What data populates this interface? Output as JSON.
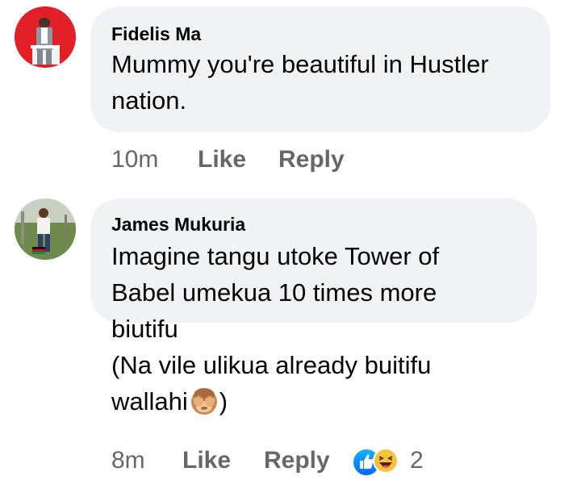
{
  "comments": [
    {
      "author": "Fidelis Ma",
      "lines": [
        "Mummy you're beautiful in Hustler",
        "nation."
      ],
      "time": "10m",
      "like_label": "Like",
      "reply_label": "Reply"
    },
    {
      "author": "James Mukuria",
      "lines": [
        "Imagine tangu utoke Tower of",
        "Babel umekua 10 times more",
        "biutifu",
        "(Na vile ulikua already buitifu",
        "wallahi",
        ")"
      ],
      "time": "8m",
      "like_label": "Like",
      "reply_label": "Reply",
      "reactions": {
        "icons": [
          "like-reaction-icon",
          "haha-reaction-icon"
        ],
        "count": "2"
      }
    }
  ],
  "colors": {
    "bubble": "#f0f2f5",
    "text": "#050505",
    "secondary": "#65676b",
    "like_blue": "#0866ff"
  }
}
